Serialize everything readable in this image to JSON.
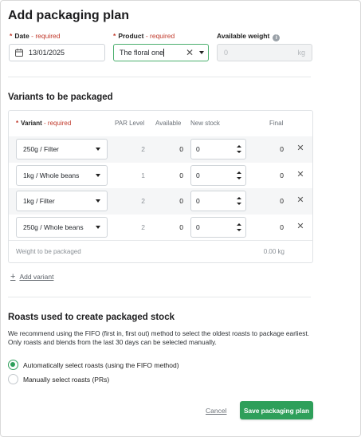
{
  "page_title": "Add packaging plan",
  "form": {
    "date": {
      "label": "Date",
      "required": "- required",
      "value": "13/01/2025"
    },
    "product": {
      "label": "Product",
      "required": "- required",
      "value": "The floral one"
    },
    "weight": {
      "label": "Available weight",
      "placeholder": "0",
      "unit": "kg"
    }
  },
  "variants_section": {
    "title": "Variants to be packaged",
    "headers": {
      "variant": "Variant",
      "variant_required": "- required",
      "par": "PAR Level",
      "available": "Available",
      "new_stock": "New stock",
      "final": "Final"
    },
    "rows": [
      {
        "variant": "250g / Filter",
        "par": "2",
        "available": "0",
        "new_stock": "0",
        "final": "0"
      },
      {
        "variant": "1kg / Whole beans",
        "par": "1",
        "available": "0",
        "new_stock": "0",
        "final": "0"
      },
      {
        "variant": "1kg / Filter",
        "par": "2",
        "available": "0",
        "new_stock": "0",
        "final": "0"
      },
      {
        "variant": "250g / Whole beans",
        "par": "2",
        "available": "0",
        "new_stock": "0",
        "final": "0"
      }
    ],
    "weight_label": "Weight to be packaged",
    "weight_value": "0.00 kg",
    "add_variant": "Add variant"
  },
  "roasts_section": {
    "title": "Roasts used to create packaged stock",
    "description": "We recommend using the FIFO (first in, first out) method to select the oldest roasts to package earliest. Only roasts and blends from the last 30 days can be selected manually.",
    "options": [
      {
        "label": "Automatically select roasts (using the FIFO method)",
        "selected": true
      },
      {
        "label": "Manually select roasts (PRs)",
        "selected": false
      }
    ]
  },
  "actions": {
    "cancel": "Cancel",
    "save": "Save packaging plan"
  },
  "colors": {
    "accent": "#2e9f5a",
    "required": "#c0392b"
  }
}
